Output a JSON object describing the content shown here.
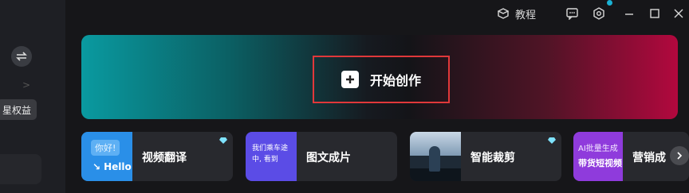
{
  "topbar": {
    "tutorial_label": "教程",
    "icons": [
      "cube-icon",
      "feedback-icon",
      "settings-icon",
      "minimize-icon",
      "maximize-icon",
      "close-icon"
    ]
  },
  "sidebar": {
    "rights_label": "星权益"
  },
  "hero": {
    "start_label": "开始创作"
  },
  "cards": [
    {
      "label": "视频翻译",
      "thumb_hi": "你好!",
      "thumb_hello": "Hello",
      "premium": true
    },
    {
      "label": "图文成片",
      "thumb_text": "我们乘车途中, 看到",
      "premium": false
    },
    {
      "label": "智能裁剪",
      "premium": true
    },
    {
      "label": "营销成",
      "thumb_line1": "AI批量生成",
      "thumb_line2": "带货短视频",
      "premium": false
    }
  ],
  "colors": {
    "accent_teal": "#0a9aa0",
    "accent_red": "#b2083e",
    "highlight_border": "#e0383a",
    "notify_dot": "#1ab2d4",
    "premium_gem": "#7fe3ff"
  }
}
